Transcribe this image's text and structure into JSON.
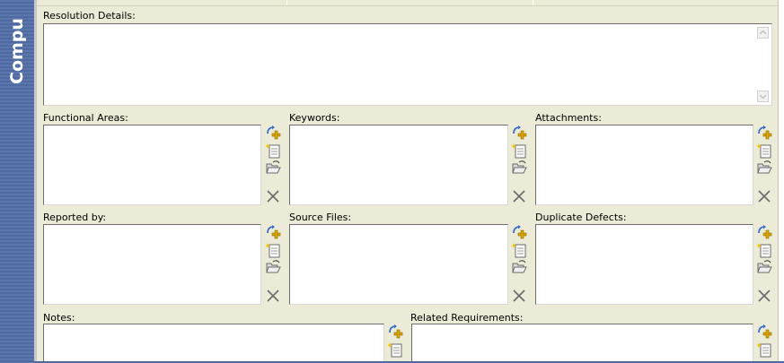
{
  "sidebar": {
    "title": "Compu"
  },
  "resolution": {
    "label": "Resolution Details:"
  },
  "fields": {
    "functional_areas": "Functional Areas:",
    "keywords": "Keywords:",
    "attachments": "Attachments:",
    "reported_by": "Reported by:",
    "source_files": "Source Files:",
    "duplicate_defects": "Duplicate Defects:",
    "notes": "Notes:",
    "related_requirements": "Related Requirements:"
  },
  "icons": [
    "add-icon",
    "new-document-icon",
    "open-folder-icon",
    "remove-icon"
  ],
  "colors": {
    "sidebar": "#5470a6",
    "panel": "#ecebd7",
    "field_border": "#7f9db9"
  }
}
